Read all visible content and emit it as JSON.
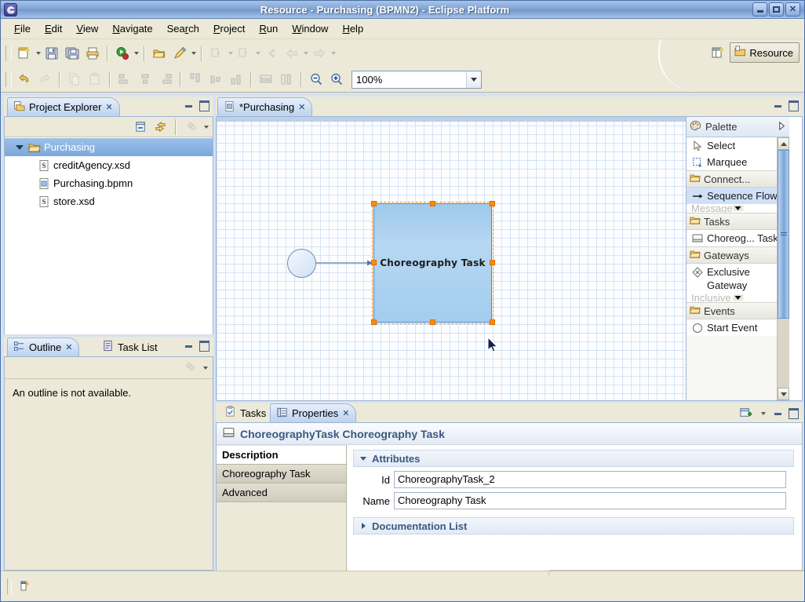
{
  "window": {
    "title": "Resource - Purchasing (BPMN2) - Eclipse Platform",
    "minimize": "_",
    "maximize": "□",
    "close": "✕"
  },
  "menu": {
    "items": [
      {
        "label": "File",
        "mnemonic": "F"
      },
      {
        "label": "Edit",
        "mnemonic": "E"
      },
      {
        "label": "View",
        "mnemonic": "V"
      },
      {
        "label": "Navigate",
        "mnemonic": "N"
      },
      {
        "label": "Search",
        "mnemonic": "r"
      },
      {
        "label": "Project",
        "mnemonic": "P"
      },
      {
        "label": "Run",
        "mnemonic": "R"
      },
      {
        "label": "Window",
        "mnemonic": "W"
      },
      {
        "label": "Help",
        "mnemonic": "H"
      }
    ]
  },
  "toolbar": {
    "zoom_value": "100%",
    "perspective_label": "Resource"
  },
  "project_explorer": {
    "tab_label": "Project Explorer",
    "close_glyph": "✕",
    "tree": [
      {
        "label": "Purchasing",
        "type": "project",
        "selected": true,
        "depth": 0
      },
      {
        "label": "creditAgency.xsd",
        "type": "xsd",
        "selected": false,
        "depth": 1
      },
      {
        "label": "Purchasing.bpmn",
        "type": "bpmn",
        "selected": false,
        "depth": 1
      },
      {
        "label": "store.xsd",
        "type": "xsd",
        "selected": false,
        "depth": 1
      }
    ]
  },
  "outline": {
    "tabs": [
      {
        "label": "Outline",
        "active": true
      },
      {
        "label": "Task List",
        "active": false
      }
    ],
    "close_glyph": "✕",
    "message": "An outline is not available."
  },
  "editor": {
    "tab_label": "*Purchasing",
    "close_glyph": "✕",
    "diagram": {
      "start_event": {
        "name": "start-event"
      },
      "task": {
        "label": "Choreography Task"
      },
      "connection": {
        "name": "sequence-flow-connection"
      }
    }
  },
  "palette": {
    "title": "Palette",
    "groups": [
      {
        "name": "tools",
        "header": null,
        "items": [
          {
            "label": "Select",
            "icon": "arrow-cursor-icon",
            "selected": false
          },
          {
            "label": "Marquee",
            "icon": "marquee-icon",
            "selected": false
          }
        ]
      },
      {
        "name": "connections",
        "header": "Connect...",
        "items": [
          {
            "label": "Sequence Flow",
            "icon": "sequence-flow-icon",
            "selected": true
          },
          {
            "label": "Message",
            "icon": "message-flow-icon",
            "selected": false,
            "clipped": true
          }
        ]
      },
      {
        "name": "tasks",
        "header": "Tasks",
        "items": [
          {
            "label": "Choreog... Task",
            "icon": "choreography-task-icon",
            "selected": false
          }
        ]
      },
      {
        "name": "gateways",
        "header": "Gateways",
        "items": [
          {
            "label": "Exclusive Gateway",
            "icon": "exclusive-gateway-icon",
            "selected": false
          },
          {
            "label": "Inclusive",
            "icon": "inclusive-gateway-icon",
            "selected": false,
            "clipped": true
          }
        ]
      },
      {
        "name": "events",
        "header": "Events",
        "items": [
          {
            "label": "Start Event",
            "icon": "start-event-icon",
            "selected": false
          }
        ]
      }
    ]
  },
  "properties": {
    "tabs": [
      {
        "label": "Tasks",
        "active": false
      },
      {
        "label": "Properties",
        "active": true
      }
    ],
    "close_glyph": "✕",
    "header_title": "ChoreographyTask Choreography Task",
    "side_tabs": [
      {
        "label": "Description",
        "active": true
      },
      {
        "label": "Choreography Task",
        "active": false
      },
      {
        "label": "Advanced",
        "active": false
      }
    ],
    "sections": [
      {
        "label": "Attributes",
        "expanded": true
      },
      {
        "label": "Documentation List",
        "expanded": false
      }
    ],
    "fields": [
      {
        "label": "Id",
        "value": "ChoreographyTask_2"
      },
      {
        "label": "Name",
        "value": "Choreography Task"
      }
    ]
  },
  "statusbar": {
    "icon": "editor-position-icon",
    "text": ""
  },
  "colors": {
    "title_bar": "#7fa3d4",
    "selection_orange": "#ff8c00",
    "task_fill": "#a3cdee",
    "tree_selection": "#7aa9dc",
    "palette_selection": "#cfe0f7",
    "section_text": "#3a5980"
  }
}
